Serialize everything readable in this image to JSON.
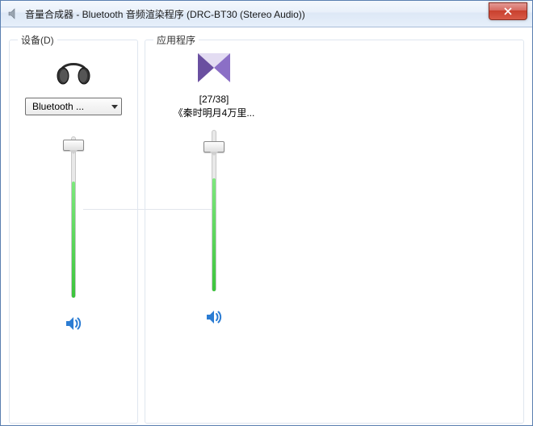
{
  "window": {
    "title": "音量合成器 - Bluetooth 音频渲染程序 (DRC-BT30 (Stereo Audio))"
  },
  "device": {
    "group_label": "设备(D)",
    "dropdown_label": "Bluetooth ...",
    "slider_percent": 95,
    "level_percent": 72
  },
  "apps": {
    "group_label": "应用程序",
    "items": [
      {
        "line1": "[27/38]",
        "line2": "《秦时明月4万里...",
        "slider_percent": 90,
        "level_percent": 70
      }
    ]
  }
}
